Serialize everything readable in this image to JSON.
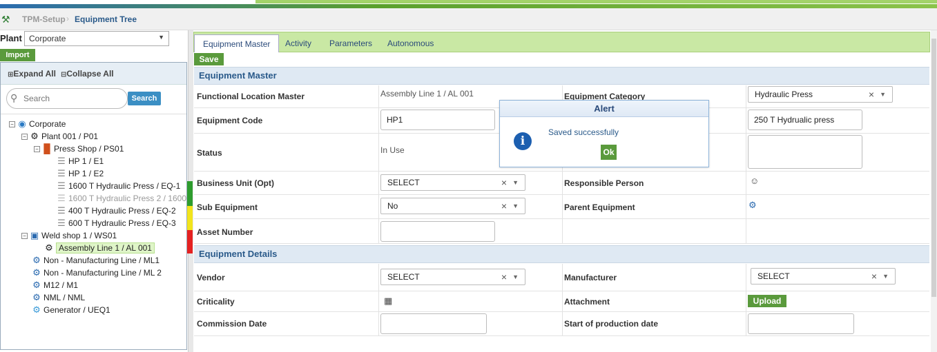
{
  "breadcrumb": {
    "root": "TPM-Setup",
    "current": "Equipment Tree"
  },
  "left": {
    "plant_label": "Plant",
    "plant_value": "Corporate",
    "import_label": "Import",
    "expand_all": "Expand All",
    "collapse_all": "Collapse All",
    "search_placeholder": "Search",
    "search_button": "Search",
    "tree": [
      {
        "label": "Corporate"
      },
      {
        "label": "Plant 001 / P01"
      },
      {
        "label": "Press Shop / PS01"
      },
      {
        "label": "HP 1 / E1"
      },
      {
        "label": "HP 1 / E2"
      },
      {
        "label": "1600 T Hydraulic Press / EQ-1"
      },
      {
        "label": "1600 T Hydraulic Press 2 / 1600"
      },
      {
        "label": "400 T Hydraulic Press / EQ-2"
      },
      {
        "label": "600 T Hydraulic Press / EQ-3"
      },
      {
        "label": "Weld shop 1 / WS01"
      },
      {
        "label": "Assembly Line 1 / AL 001"
      },
      {
        "label": "Non - Manufacturing Line / ML1"
      },
      {
        "label": "Non - Manufacturing Line / ML 2"
      },
      {
        "label": "M12 / M1"
      },
      {
        "label": "NML / NML"
      },
      {
        "label": "Generator / UEQ1"
      }
    ]
  },
  "tabs": [
    "Equipment Master",
    "Activity",
    "Parameters",
    "Autonomous"
  ],
  "save_label": "Save",
  "master": {
    "title": "Equipment Master",
    "functional_location_label": "Functional Location Master",
    "functional_location_value": "Assembly Line 1 / AL 001",
    "equipment_category_label": "Equipment Category",
    "equipment_category_value": "Hydraulic Press",
    "equipment_code_label": "Equipment Code",
    "equipment_code_value": "HP1",
    "equipment_desc_value": "250 T Hydrualic press",
    "status_label": "Status",
    "status_value": "In Use",
    "business_unit_label": "Business Unit (Opt)",
    "business_unit_value": "SELECT",
    "responsible_person_label": "Responsible Person",
    "sub_equipment_label": "Sub Equipment",
    "sub_equipment_value": "No",
    "parent_equipment_label": "Parent Equipment",
    "asset_number_label": "Asset Number"
  },
  "details": {
    "title": "Equipment Details",
    "vendor_label": "Vendor",
    "vendor_value": "SELECT",
    "manufacturer_label": "Manufacturer",
    "manufacturer_value": "SELECT",
    "criticality_label": "Criticality",
    "attachment_label": "Attachment",
    "upload_label": "Upload",
    "commission_date_label": "Commission Date",
    "start_production_label": "Start of production date"
  },
  "alert": {
    "title": "Alert",
    "message": "Saved successfully",
    "ok_label": "Ok"
  },
  "colors": {
    "accent_green": "#5a9a3c",
    "header_blue": "#2a5a8a",
    "tab_bg": "#c9e8a4"
  }
}
